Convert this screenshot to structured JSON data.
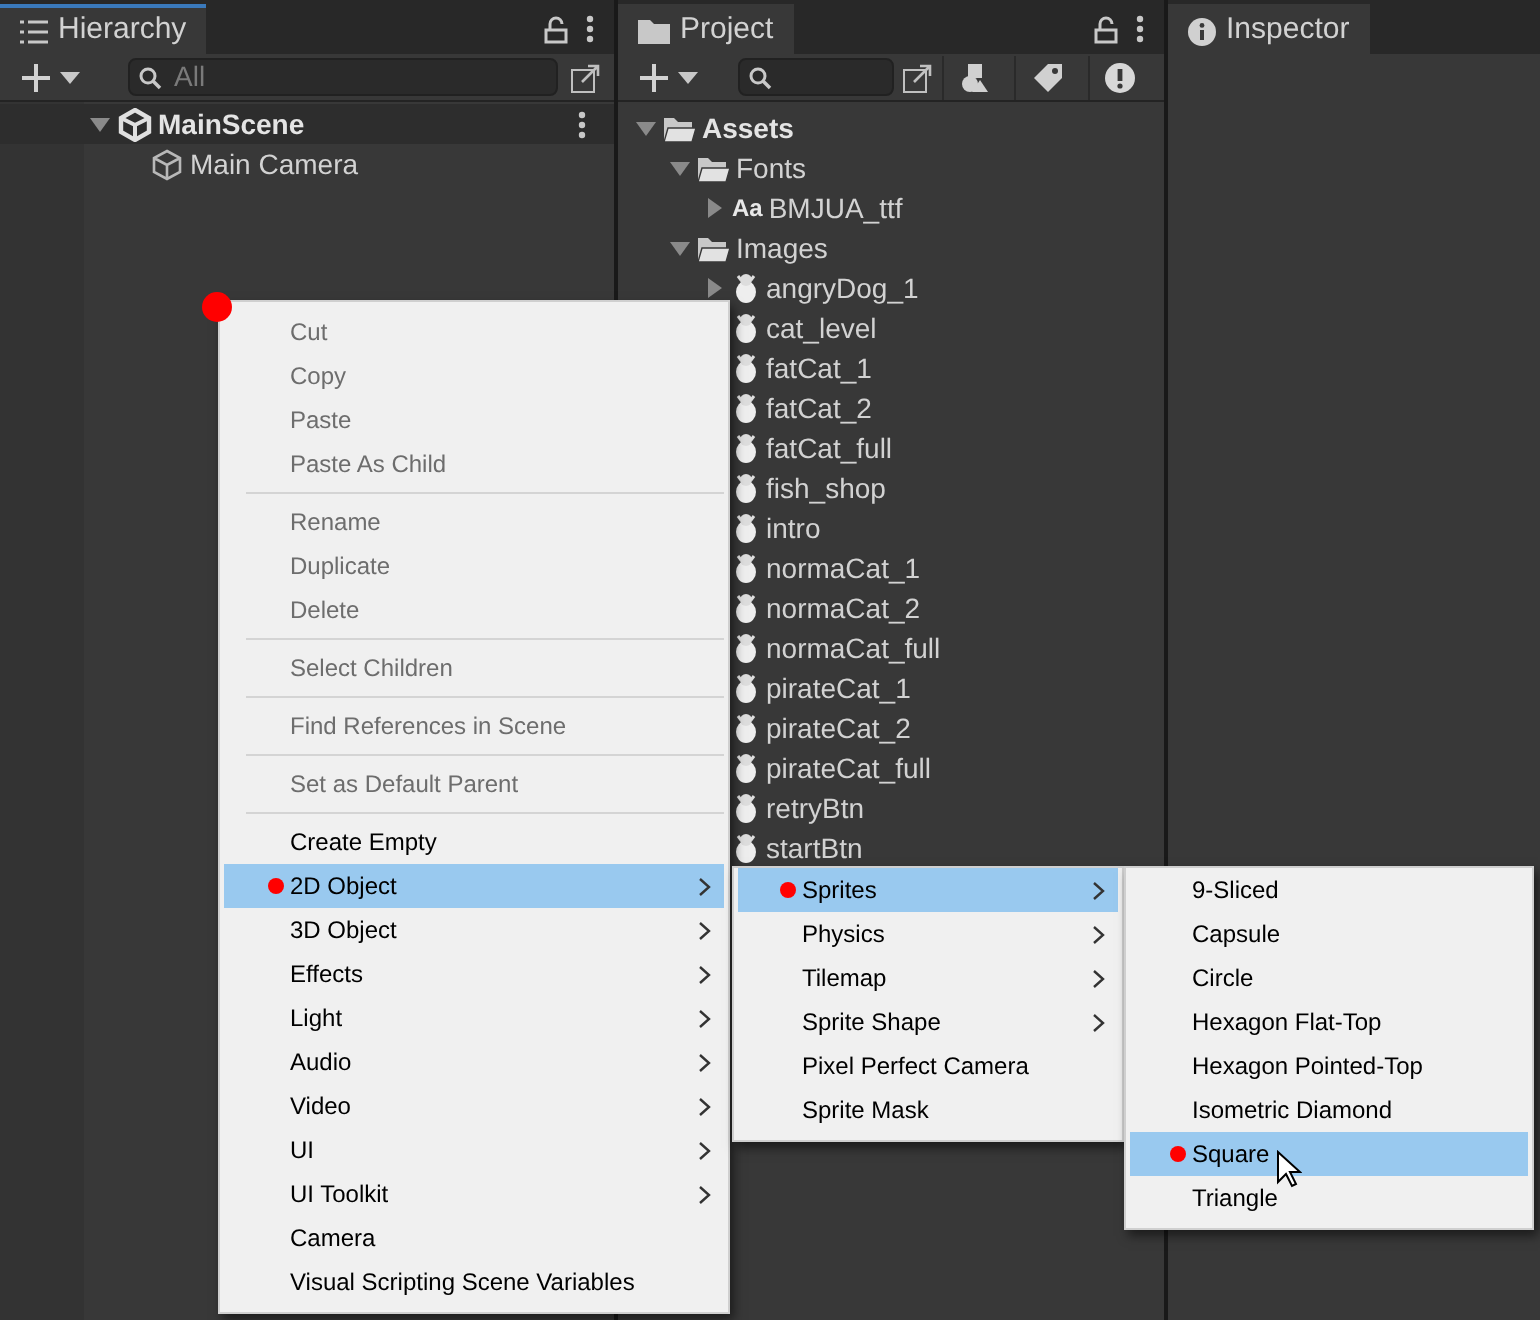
{
  "hierarchy": {
    "title": "Hierarchy",
    "search": {
      "placeholder": "All"
    },
    "items": [
      {
        "label": "MainScene",
        "kind": "scene",
        "expanded": true,
        "children": [
          {
            "label": "Main Camera",
            "kind": "gameobject"
          }
        ]
      }
    ]
  },
  "project": {
    "title": "Project",
    "items": [
      {
        "label": "Assets",
        "kind": "folder",
        "expanded": true,
        "children": [
          {
            "label": "Fonts",
            "kind": "folder",
            "expanded": true,
            "children": [
              {
                "label": "BMJUA_ttf",
                "kind": "font",
                "icon_text": "Aa",
                "expanded": false
              }
            ]
          },
          {
            "label": "Images",
            "kind": "folder",
            "expanded": true,
            "children": [
              {
                "label": "angryDog_1",
                "kind": "image",
                "expanded": false
              },
              {
                "label": "cat_level",
                "kind": "image"
              },
              {
                "label": "fatCat_1",
                "kind": "image"
              },
              {
                "label": "fatCat_2",
                "kind": "image"
              },
              {
                "label": "fatCat_full",
                "kind": "image"
              },
              {
                "label": "fish_shop",
                "kind": "image"
              },
              {
                "label": "intro",
                "kind": "image"
              },
              {
                "label": "normaCat_1",
                "kind": "image"
              },
              {
                "label": "normaCat_2",
                "kind": "image"
              },
              {
                "label": "normaCat_full",
                "kind": "image"
              },
              {
                "label": "pirateCat_1",
                "kind": "image"
              },
              {
                "label": "pirateCat_2",
                "kind": "image"
              },
              {
                "label": "pirateCat_full",
                "kind": "image"
              },
              {
                "label": "retryBtn",
                "kind": "image"
              },
              {
                "label": "startBtn",
                "kind": "image"
              }
            ]
          }
        ]
      }
    ]
  },
  "inspector": {
    "title": "Inspector"
  },
  "menus": [
    {
      "items": [
        {
          "kind": "item",
          "label": "Cut",
          "disabled": true,
          "submenu": false,
          "selected": false,
          "marked": false
        },
        {
          "kind": "item",
          "label": "Copy",
          "disabled": true,
          "submenu": false,
          "selected": false,
          "marked": false
        },
        {
          "kind": "item",
          "label": "Paste",
          "disabled": true,
          "submenu": false,
          "selected": false,
          "marked": false
        },
        {
          "kind": "item",
          "label": "Paste As Child",
          "disabled": true,
          "submenu": false,
          "selected": false,
          "marked": false
        },
        {
          "kind": "separator"
        },
        {
          "kind": "item",
          "label": "Rename",
          "disabled": true,
          "submenu": false,
          "selected": false,
          "marked": false
        },
        {
          "kind": "item",
          "label": "Duplicate",
          "disabled": true,
          "submenu": false,
          "selected": false,
          "marked": false
        },
        {
          "kind": "item",
          "label": "Delete",
          "disabled": true,
          "submenu": false,
          "selected": false,
          "marked": false
        },
        {
          "kind": "separator"
        },
        {
          "kind": "item",
          "label": "Select Children",
          "disabled": true,
          "submenu": false,
          "selected": false,
          "marked": false
        },
        {
          "kind": "separator"
        },
        {
          "kind": "item",
          "label": "Find References in Scene",
          "disabled": true,
          "submenu": false,
          "selected": false,
          "marked": false
        },
        {
          "kind": "separator"
        },
        {
          "kind": "item",
          "label": "Set as Default Parent",
          "disabled": true,
          "submenu": false,
          "selected": false,
          "marked": false
        },
        {
          "kind": "separator"
        },
        {
          "kind": "item",
          "label": "Create Empty",
          "disabled": false,
          "submenu": false,
          "selected": false,
          "marked": false
        },
        {
          "kind": "item",
          "label": "2D Object",
          "disabled": false,
          "submenu": true,
          "selected": true,
          "marked": true
        },
        {
          "kind": "item",
          "label": "3D Object",
          "disabled": false,
          "submenu": true,
          "selected": false,
          "marked": false
        },
        {
          "kind": "item",
          "label": "Effects",
          "disabled": false,
          "submenu": true,
          "selected": false,
          "marked": false
        },
        {
          "kind": "item",
          "label": "Light",
          "disabled": false,
          "submenu": true,
          "selected": false,
          "marked": false
        },
        {
          "kind": "item",
          "label": "Audio",
          "disabled": false,
          "submenu": true,
          "selected": false,
          "marked": false
        },
        {
          "kind": "item",
          "label": "Video",
          "disabled": false,
          "submenu": true,
          "selected": false,
          "marked": false
        },
        {
          "kind": "item",
          "label": "UI",
          "disabled": false,
          "submenu": true,
          "selected": false,
          "marked": false
        },
        {
          "kind": "item",
          "label": "UI Toolkit",
          "disabled": false,
          "submenu": true,
          "selected": false,
          "marked": false
        },
        {
          "kind": "item",
          "label": "Camera",
          "disabled": false,
          "submenu": false,
          "selected": false,
          "marked": false
        },
        {
          "kind": "item",
          "label": "Visual Scripting Scene Variables",
          "disabled": false,
          "submenu": false,
          "selected": false,
          "marked": false
        }
      ]
    },
    {
      "items": [
        {
          "kind": "item",
          "label": "Sprites",
          "disabled": false,
          "submenu": true,
          "selected": true,
          "marked": true
        },
        {
          "kind": "item",
          "label": "Physics",
          "disabled": false,
          "submenu": true,
          "selected": false,
          "marked": false
        },
        {
          "kind": "item",
          "label": "Tilemap",
          "disabled": false,
          "submenu": true,
          "selected": false,
          "marked": false
        },
        {
          "kind": "item",
          "label": "Sprite Shape",
          "disabled": false,
          "submenu": true,
          "selected": false,
          "marked": false
        },
        {
          "kind": "item",
          "label": "Pixel Perfect Camera",
          "disabled": false,
          "submenu": false,
          "selected": false,
          "marked": false
        },
        {
          "kind": "item",
          "label": "Sprite Mask",
          "disabled": false,
          "submenu": false,
          "selected": false,
          "marked": false
        }
      ]
    },
    {
      "items": [
        {
          "kind": "item",
          "label": "9-Sliced",
          "disabled": false,
          "submenu": false,
          "selected": false,
          "marked": false
        },
        {
          "kind": "item",
          "label": "Capsule",
          "disabled": false,
          "submenu": false,
          "selected": false,
          "marked": false
        },
        {
          "kind": "item",
          "label": "Circle",
          "disabled": false,
          "submenu": false,
          "selected": false,
          "marked": false
        },
        {
          "kind": "item",
          "label": "Hexagon Flat-Top",
          "disabled": false,
          "submenu": false,
          "selected": false,
          "marked": false
        },
        {
          "kind": "item",
          "label": "Hexagon Pointed-Top",
          "disabled": false,
          "submenu": false,
          "selected": false,
          "marked": false
        },
        {
          "kind": "item",
          "label": "Isometric Diamond",
          "disabled": false,
          "submenu": false,
          "selected": false,
          "marked": false
        },
        {
          "kind": "item",
          "label": "Square",
          "disabled": false,
          "submenu": false,
          "selected": true,
          "marked": true
        },
        {
          "kind": "item",
          "label": "Triangle",
          "disabled": false,
          "submenu": false,
          "selected": false,
          "marked": false
        }
      ]
    }
  ]
}
